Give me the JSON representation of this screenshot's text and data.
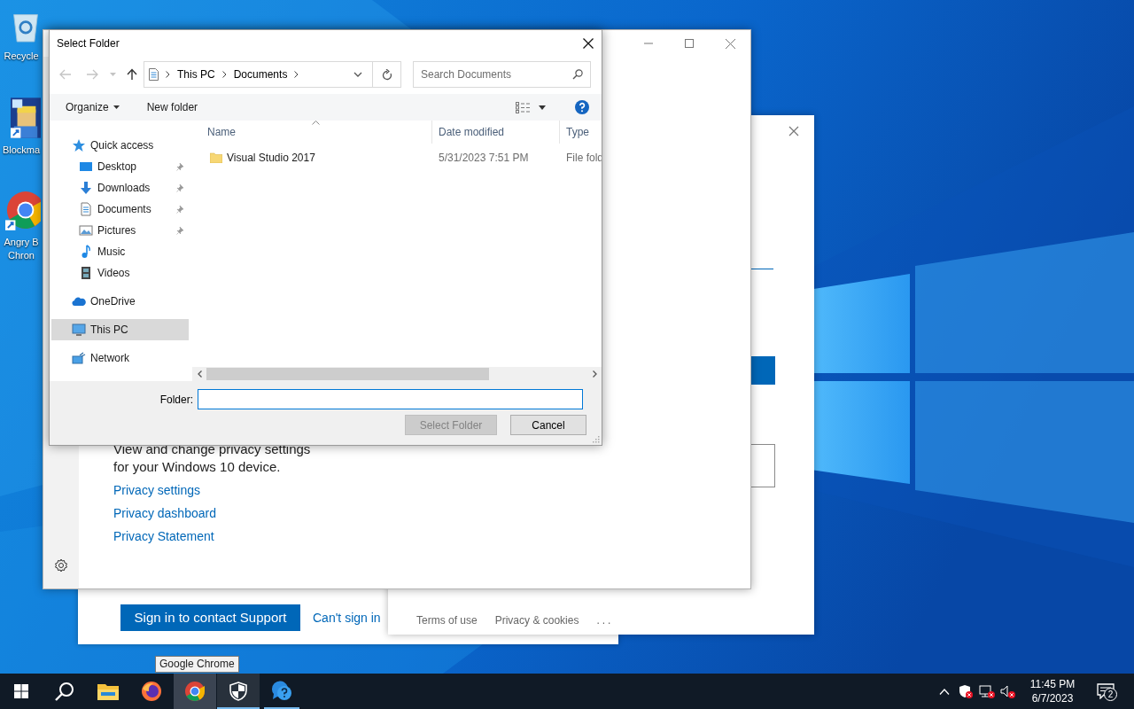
{
  "desktop_icons": [
    {
      "kind": "recycle",
      "label_lines": [
        "Recycle"
      ]
    },
    {
      "kind": "game",
      "label_lines": [
        "Blockma"
      ]
    },
    {
      "kind": "chrome",
      "label_lines": [
        "Angry B",
        "Chron"
      ]
    }
  ],
  "support_window": {
    "primary_button": "Sign in to contact Support",
    "link": "Can't sign in"
  },
  "account_window": {
    "footer_links": [
      "Terms of use",
      "Privacy & cookies"
    ],
    "more": "..."
  },
  "settings_window": {
    "description_lines": [
      "View and change privacy settings",
      "for your Windows 10 device."
    ],
    "links": [
      "Privacy settings",
      "Privacy dashboard",
      "Privacy Statement"
    ]
  },
  "dialog": {
    "title": "Select Folder",
    "breadcrumb": [
      "This PC",
      "Documents"
    ],
    "search": {
      "placeholder": "Search Documents"
    },
    "toolbar": {
      "organize": "Organize",
      "new_folder": "New folder"
    },
    "nav": [
      {
        "label": "Quick access",
        "kind": "star",
        "selected": false,
        "pinned": false,
        "children": [
          {
            "label": "Desktop",
            "kind": "desktop",
            "selected": false,
            "pinned": true
          },
          {
            "label": "Downloads",
            "kind": "download",
            "selected": false,
            "pinned": true
          },
          {
            "label": "Documents",
            "kind": "document",
            "selected": false,
            "pinned": true
          },
          {
            "label": "Pictures",
            "kind": "picture",
            "selected": false,
            "pinned": true
          },
          {
            "label": "Music",
            "kind": "music",
            "selected": false,
            "pinned": false
          },
          {
            "label": "Videos",
            "kind": "video",
            "selected": false,
            "pinned": false
          }
        ]
      },
      {
        "label": "OneDrive",
        "kind": "cloud",
        "selected": false,
        "pinned": false
      },
      {
        "label": "This PC",
        "kind": "pc",
        "selected": true,
        "pinned": false
      },
      {
        "label": "Network",
        "kind": "network",
        "selected": false,
        "pinned": false
      }
    ],
    "columns": [
      {
        "label": "Name",
        "sorted": true
      },
      {
        "label": "Date modified",
        "sorted": false
      },
      {
        "label": "Type",
        "sorted": false
      }
    ],
    "rows": [
      {
        "cells": [
          "Visual Studio 2017",
          "5/31/2023 7:51 PM",
          "File fold"
        ]
      }
    ],
    "folder_field": {
      "label": "Folder:",
      "focused": true
    },
    "buttons": [
      {
        "label": "Select Folder",
        "disabled": true
      },
      {
        "label": "Cancel",
        "disabled": false
      }
    ]
  },
  "taskbar": {
    "buttons": [
      {
        "kind": "start",
        "hovered": false,
        "active": false,
        "running": false
      },
      {
        "kind": "search",
        "hovered": false,
        "active": false,
        "running": false
      },
      {
        "kind": "explorer",
        "hovered": false,
        "active": false,
        "running": false
      },
      {
        "kind": "firefox",
        "hovered": false,
        "active": false,
        "running": false
      },
      {
        "kind": "chrome",
        "hovered": true,
        "active": false,
        "running": false
      },
      {
        "kind": "shield",
        "hovered": false,
        "active": true,
        "running": true
      },
      {
        "kind": "help",
        "hovered": false,
        "active": false,
        "running": true
      }
    ],
    "tooltip": "Google Chrome",
    "clock": {
      "time": "11:45 PM",
      "date": "6/7/2023"
    },
    "notifications": "2"
  }
}
